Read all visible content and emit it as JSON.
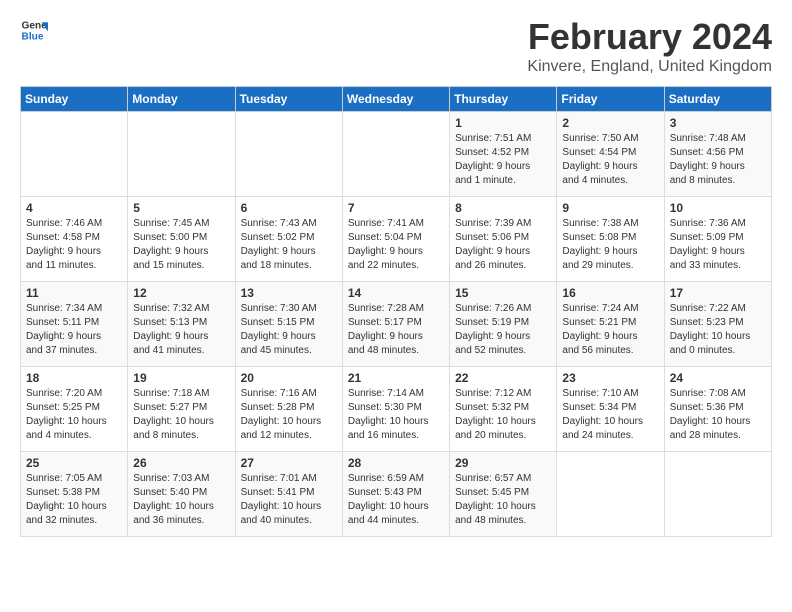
{
  "header": {
    "logo_line1": "General",
    "logo_line2": "Blue",
    "month": "February 2024",
    "location": "Kinvere, England, United Kingdom"
  },
  "weekdays": [
    "Sunday",
    "Monday",
    "Tuesday",
    "Wednesday",
    "Thursday",
    "Friday",
    "Saturday"
  ],
  "weeks": [
    [
      {
        "day": "",
        "info": ""
      },
      {
        "day": "",
        "info": ""
      },
      {
        "day": "",
        "info": ""
      },
      {
        "day": "",
        "info": ""
      },
      {
        "day": "1",
        "info": "Sunrise: 7:51 AM\nSunset: 4:52 PM\nDaylight: 9 hours\nand 1 minute."
      },
      {
        "day": "2",
        "info": "Sunrise: 7:50 AM\nSunset: 4:54 PM\nDaylight: 9 hours\nand 4 minutes."
      },
      {
        "day": "3",
        "info": "Sunrise: 7:48 AM\nSunset: 4:56 PM\nDaylight: 9 hours\nand 8 minutes."
      }
    ],
    [
      {
        "day": "4",
        "info": "Sunrise: 7:46 AM\nSunset: 4:58 PM\nDaylight: 9 hours\nand 11 minutes."
      },
      {
        "day": "5",
        "info": "Sunrise: 7:45 AM\nSunset: 5:00 PM\nDaylight: 9 hours\nand 15 minutes."
      },
      {
        "day": "6",
        "info": "Sunrise: 7:43 AM\nSunset: 5:02 PM\nDaylight: 9 hours\nand 18 minutes."
      },
      {
        "day": "7",
        "info": "Sunrise: 7:41 AM\nSunset: 5:04 PM\nDaylight: 9 hours\nand 22 minutes."
      },
      {
        "day": "8",
        "info": "Sunrise: 7:39 AM\nSunset: 5:06 PM\nDaylight: 9 hours\nand 26 minutes."
      },
      {
        "day": "9",
        "info": "Sunrise: 7:38 AM\nSunset: 5:08 PM\nDaylight: 9 hours\nand 29 minutes."
      },
      {
        "day": "10",
        "info": "Sunrise: 7:36 AM\nSunset: 5:09 PM\nDaylight: 9 hours\nand 33 minutes."
      }
    ],
    [
      {
        "day": "11",
        "info": "Sunrise: 7:34 AM\nSunset: 5:11 PM\nDaylight: 9 hours\nand 37 minutes."
      },
      {
        "day": "12",
        "info": "Sunrise: 7:32 AM\nSunset: 5:13 PM\nDaylight: 9 hours\nand 41 minutes."
      },
      {
        "day": "13",
        "info": "Sunrise: 7:30 AM\nSunset: 5:15 PM\nDaylight: 9 hours\nand 45 minutes."
      },
      {
        "day": "14",
        "info": "Sunrise: 7:28 AM\nSunset: 5:17 PM\nDaylight: 9 hours\nand 48 minutes."
      },
      {
        "day": "15",
        "info": "Sunrise: 7:26 AM\nSunset: 5:19 PM\nDaylight: 9 hours\nand 52 minutes."
      },
      {
        "day": "16",
        "info": "Sunrise: 7:24 AM\nSunset: 5:21 PM\nDaylight: 9 hours\nand 56 minutes."
      },
      {
        "day": "17",
        "info": "Sunrise: 7:22 AM\nSunset: 5:23 PM\nDaylight: 10 hours\nand 0 minutes."
      }
    ],
    [
      {
        "day": "18",
        "info": "Sunrise: 7:20 AM\nSunset: 5:25 PM\nDaylight: 10 hours\nand 4 minutes."
      },
      {
        "day": "19",
        "info": "Sunrise: 7:18 AM\nSunset: 5:27 PM\nDaylight: 10 hours\nand 8 minutes."
      },
      {
        "day": "20",
        "info": "Sunrise: 7:16 AM\nSunset: 5:28 PM\nDaylight: 10 hours\nand 12 minutes."
      },
      {
        "day": "21",
        "info": "Sunrise: 7:14 AM\nSunset: 5:30 PM\nDaylight: 10 hours\nand 16 minutes."
      },
      {
        "day": "22",
        "info": "Sunrise: 7:12 AM\nSunset: 5:32 PM\nDaylight: 10 hours\nand 20 minutes."
      },
      {
        "day": "23",
        "info": "Sunrise: 7:10 AM\nSunset: 5:34 PM\nDaylight: 10 hours\nand 24 minutes."
      },
      {
        "day": "24",
        "info": "Sunrise: 7:08 AM\nSunset: 5:36 PM\nDaylight: 10 hours\nand 28 minutes."
      }
    ],
    [
      {
        "day": "25",
        "info": "Sunrise: 7:05 AM\nSunset: 5:38 PM\nDaylight: 10 hours\nand 32 minutes."
      },
      {
        "day": "26",
        "info": "Sunrise: 7:03 AM\nSunset: 5:40 PM\nDaylight: 10 hours\nand 36 minutes."
      },
      {
        "day": "27",
        "info": "Sunrise: 7:01 AM\nSunset: 5:41 PM\nDaylight: 10 hours\nand 40 minutes."
      },
      {
        "day": "28",
        "info": "Sunrise: 6:59 AM\nSunset: 5:43 PM\nDaylight: 10 hours\nand 44 minutes."
      },
      {
        "day": "29",
        "info": "Sunrise: 6:57 AM\nSunset: 5:45 PM\nDaylight: 10 hours\nand 48 minutes."
      },
      {
        "day": "",
        "info": ""
      },
      {
        "day": "",
        "info": ""
      }
    ]
  ]
}
